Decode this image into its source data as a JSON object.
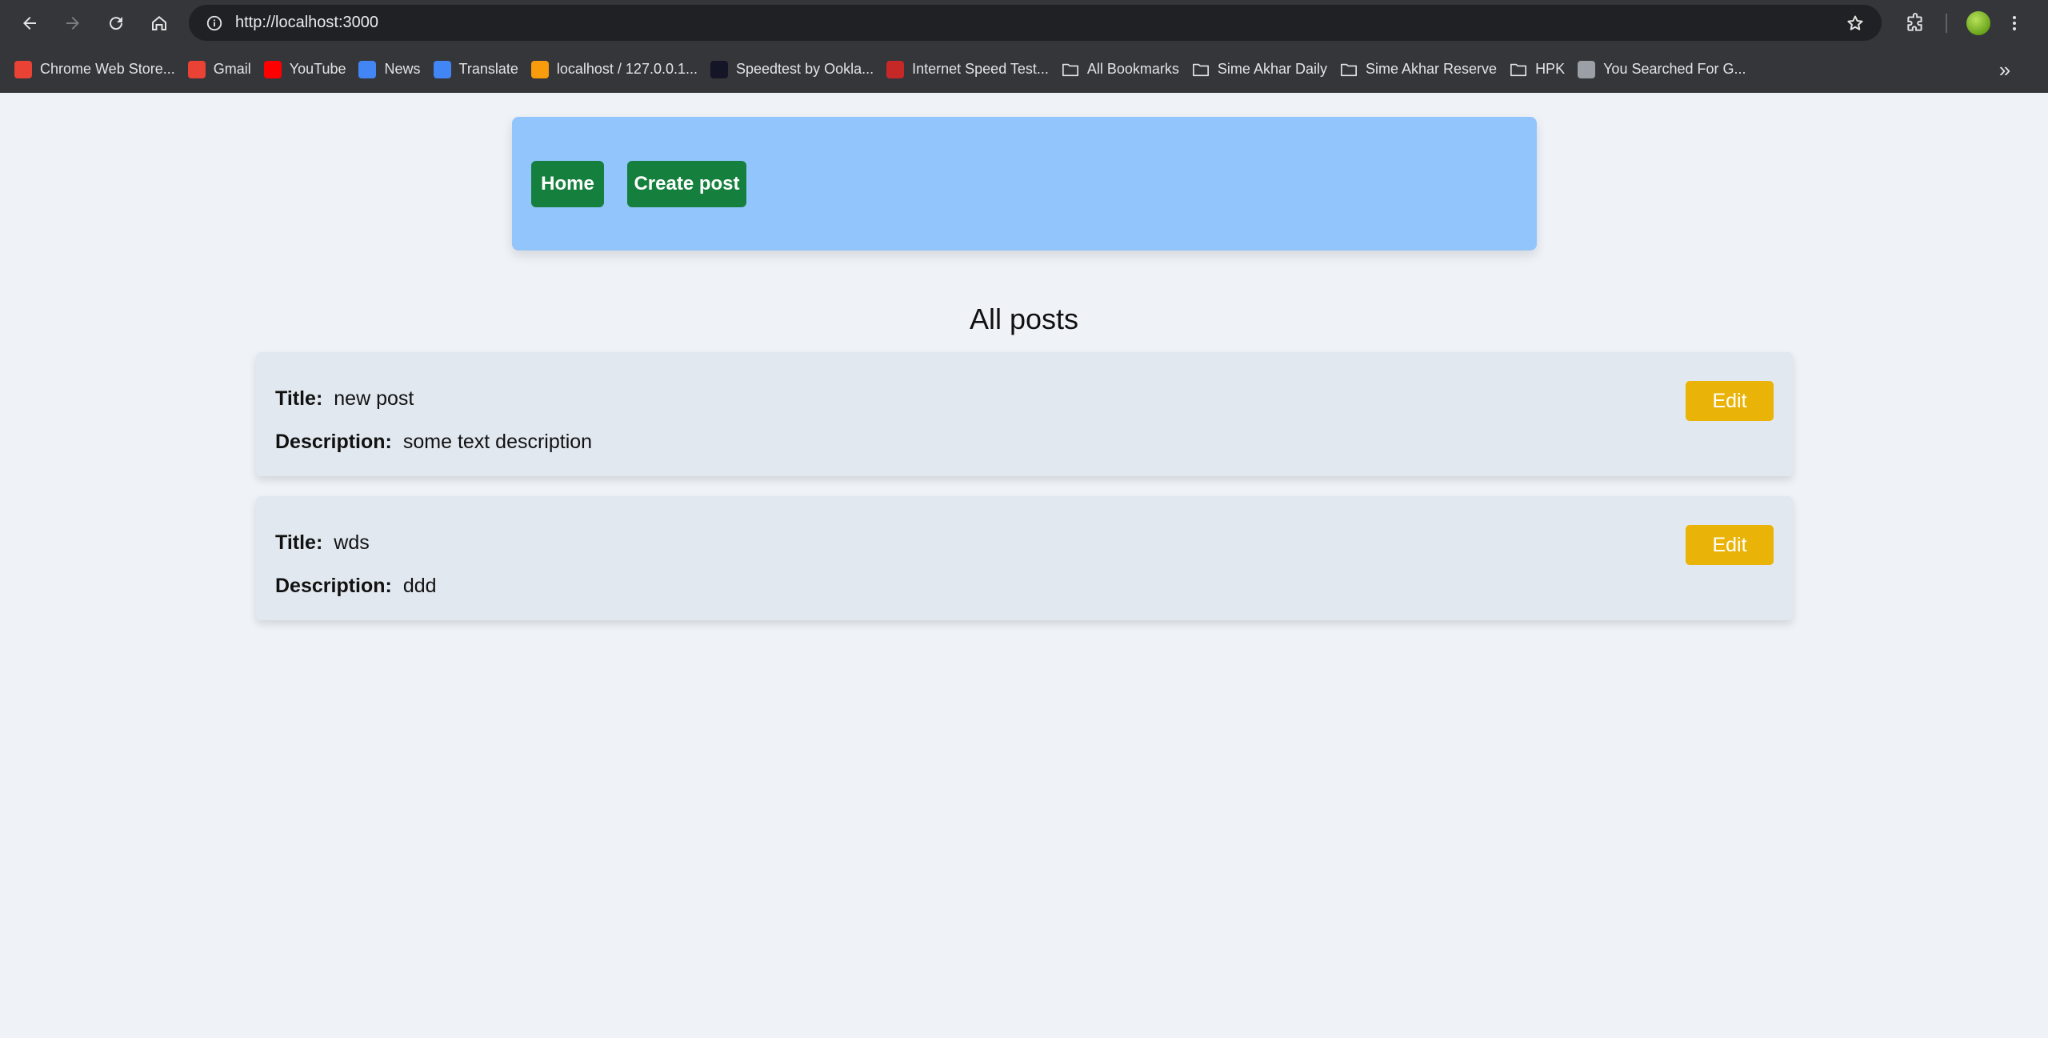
{
  "browser": {
    "url": "http://localhost:3000",
    "bookmarks": [
      {
        "label": "Chrome Web Store...",
        "icon": "chrome-web-store-icon",
        "kind": "site",
        "color": "#ea4335"
      },
      {
        "label": "Gmail",
        "icon": "gmail-icon",
        "kind": "site",
        "color": "#ea4335"
      },
      {
        "label": "YouTube",
        "icon": "youtube-icon",
        "kind": "site",
        "color": "#ff0000"
      },
      {
        "label": "News",
        "icon": "google-news-icon",
        "kind": "site",
        "color": "#4285f4"
      },
      {
        "label": "Translate",
        "icon": "google-translate-icon",
        "kind": "site",
        "color": "#4285f4"
      },
      {
        "label": "localhost / 127.0.0.1...",
        "icon": "phpmyadmin-icon",
        "kind": "site",
        "color": "#f89c0e"
      },
      {
        "label": "Speedtest by Ookla...",
        "icon": "speedtest-icon",
        "kind": "site",
        "color": "#141526"
      },
      {
        "label": "Internet Speed Test...",
        "icon": "speed-test-gauge-icon",
        "kind": "site",
        "color": "#c62828"
      },
      {
        "label": "All Bookmarks",
        "icon": "folder-icon",
        "kind": "folder"
      },
      {
        "label": "Sime Akhar Daily",
        "icon": "folder-icon",
        "kind": "folder"
      },
      {
        "label": "Sime Akhar Reserve",
        "icon": "folder-icon",
        "kind": "folder"
      },
      {
        "label": "HPK",
        "icon": "folder-icon",
        "kind": "folder"
      },
      {
        "label": "You Searched For G...",
        "icon": "camera-icon",
        "kind": "site",
        "color": "#9aa0a6"
      }
    ]
  },
  "nav": {
    "home_label": "Home",
    "create_label": "Create post"
  },
  "heading": "All posts",
  "labels": {
    "title": "Title:",
    "description": "Description:",
    "edit": "Edit"
  },
  "posts": [
    {
      "title": "new post",
      "description": "some text description"
    },
    {
      "title": "wds",
      "description": "ddd"
    }
  ],
  "colors": {
    "navbar_bg": "#93c5fd",
    "nav_button": "#15803d",
    "edit_button": "#eab308",
    "card_bg": "#e2e8f0",
    "page_bg": "#eff3f8"
  }
}
